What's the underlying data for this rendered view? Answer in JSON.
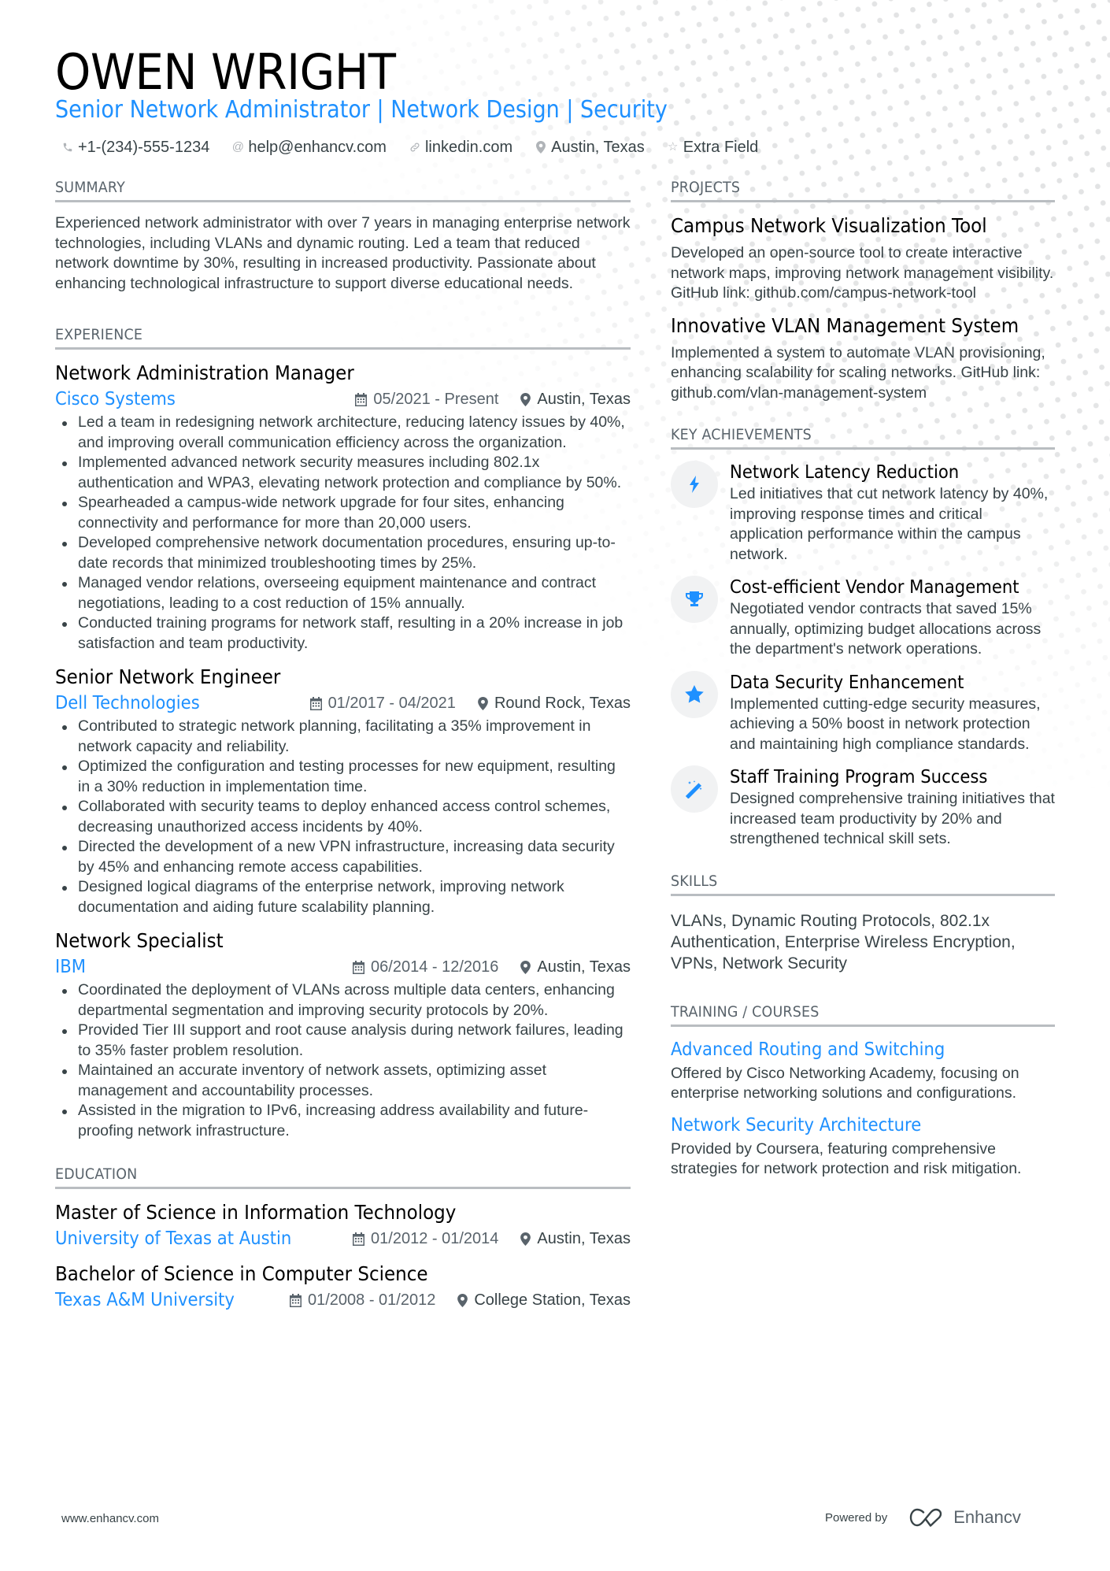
{
  "header": {
    "name": "OWEN WRIGHT",
    "headline": "Senior Network Administrator | Network Design | Security",
    "contacts": [
      {
        "icon": "phone-icon",
        "text": "+1-(234)-555-1234"
      },
      {
        "icon": "at-icon",
        "text": "help@enhancv.com"
      },
      {
        "icon": "link-icon",
        "text": "linkedin.com"
      },
      {
        "icon": "location-icon",
        "text": "Austin, Texas"
      },
      {
        "icon": "star-icon",
        "text": "Extra Field"
      }
    ]
  },
  "summary": {
    "title": "Summary",
    "text": "Experienced network administrator with over 7 years in managing enterprise network technologies, including VLANs and dynamic routing. Led a team that reduced network downtime by 30%, resulting in increased productivity. Passionate about enhancing technological infrastructure to support diverse educational needs."
  },
  "experience": {
    "title": "Experience",
    "jobs": [
      {
        "title": "Network Administration Manager",
        "company": "Cisco Systems",
        "dates": "05/2021 - Present",
        "location": "Austin, Texas",
        "bullets": [
          "Led a team in redesigning network architecture, reducing latency issues by 40%, and improving overall communication efficiency across the organization.",
          "Implemented advanced network security measures including 802.1x authentication and WPA3, elevating network protection and compliance by 50%.",
          "Spearheaded a campus-wide network upgrade for four sites, enhancing connectivity and performance for more than 20,000 users.",
          "Developed comprehensive network documentation procedures, ensuring up-to-date records that minimized troubleshooting times by 25%.",
          "Managed vendor relations, overseeing equipment maintenance and contract negotiations, leading to a cost reduction of 15% annually.",
          "Conducted training programs for network staff, resulting in a 20% increase in job satisfaction and team productivity."
        ]
      },
      {
        "title": "Senior Network Engineer",
        "company": "Dell Technologies",
        "dates": "01/2017 - 04/2021",
        "location": "Round Rock, Texas",
        "bullets": [
          "Contributed to strategic network planning, facilitating a 35% improvement in network capacity and reliability.",
          "Optimized the configuration and testing processes for new equipment, resulting in a 30% reduction in implementation time.",
          "Collaborated with security teams to deploy enhanced access control schemes, decreasing unauthorized access incidents by 40%.",
          "Directed the development of a new VPN infrastructure, increasing data security by 45% and enhancing remote access capabilities.",
          "Designed logical diagrams of the enterprise network, improving network documentation and aiding future scalability planning."
        ]
      },
      {
        "title": "Network Specialist",
        "company": "IBM",
        "dates": "06/2014 - 12/2016",
        "location": "Austin, Texas",
        "bullets": [
          "Coordinated the deployment of VLANs across multiple data centers, enhancing departmental segmentation and improving security protocols by 20%.",
          "Provided Tier III support and root cause analysis during network failures, leading to 35% faster problem resolution.",
          "Maintained an accurate inventory of network assets, optimizing asset management and accountability processes.",
          "Assisted in the migration to IPv6, increasing address availability and future-proofing network infrastructure."
        ]
      }
    ]
  },
  "education": {
    "title": "Education",
    "items": [
      {
        "degree": "Master of Science in Information Technology",
        "school": "University of Texas at Austin",
        "dates": "01/2012 - 01/2014",
        "location": "Austin, Texas"
      },
      {
        "degree": "Bachelor of Science in Computer Science",
        "school": "Texas A&M University",
        "dates": "01/2008 - 01/2012",
        "location": "College Station, Texas"
      }
    ]
  },
  "projects": {
    "title": "Projects",
    "items": [
      {
        "title": "Campus Network Visualization Tool",
        "description": "Developed an open-source tool to create interactive network maps, improving network management visibility. GitHub link: github.com/campus-network-tool"
      },
      {
        "title": "Innovative VLAN Management System",
        "description": "Implemented a system to automate VLAN provisioning, enhancing scalability for scaling networks. GitHub link: github.com/vlan-management-system"
      }
    ]
  },
  "achievements": {
    "title": "Key Achievements",
    "items": [
      {
        "icon": "bolt-icon",
        "title": "Network Latency Reduction",
        "description": "Led initiatives that cut network latency by 40%, improving response times and critical application performance within the campus network."
      },
      {
        "icon": "trophy-icon",
        "title": "Cost-efficient Vendor Management",
        "description": "Negotiated vendor contracts that saved 15% annually, optimizing budget allocations across the department's network operations."
      },
      {
        "icon": "star-icon",
        "title": "Data Security Enhancement",
        "description": "Implemented cutting-edge security measures, achieving a 50% boost in network protection and maintaining high compliance standards."
      },
      {
        "icon": "magic-wand-icon",
        "title": "Staff Training Program Success",
        "description": "Designed comprehensive training initiatives that increased team productivity by 20% and strengthened technical skill sets."
      }
    ]
  },
  "skills": {
    "title": "Skills",
    "text": "VLANs, Dynamic Routing Protocols, 802.1x Authentication, Enterprise Wireless Encryption, VPNs, Network Security"
  },
  "training": {
    "title": "Training / Courses",
    "items": [
      {
        "title": "Advanced Routing and Switching",
        "description": "Offered by Cisco Networking Academy, focusing on enterprise networking solutions and configurations."
      },
      {
        "title": "Network Security Architecture",
        "description": "Provided by Coursera, featuring comprehensive strategies for network protection and risk mitigation."
      }
    ]
  },
  "footer": {
    "website": "www.enhancv.com",
    "powered_by": "Powered by",
    "brand": "Enhancv"
  },
  "colors": {
    "accent": "#1e90ff",
    "text": "#384347",
    "heading": "#000000",
    "muted": "#59636b",
    "rule": "#b9bdc1",
    "icon_bg": "#f1f2f3"
  }
}
